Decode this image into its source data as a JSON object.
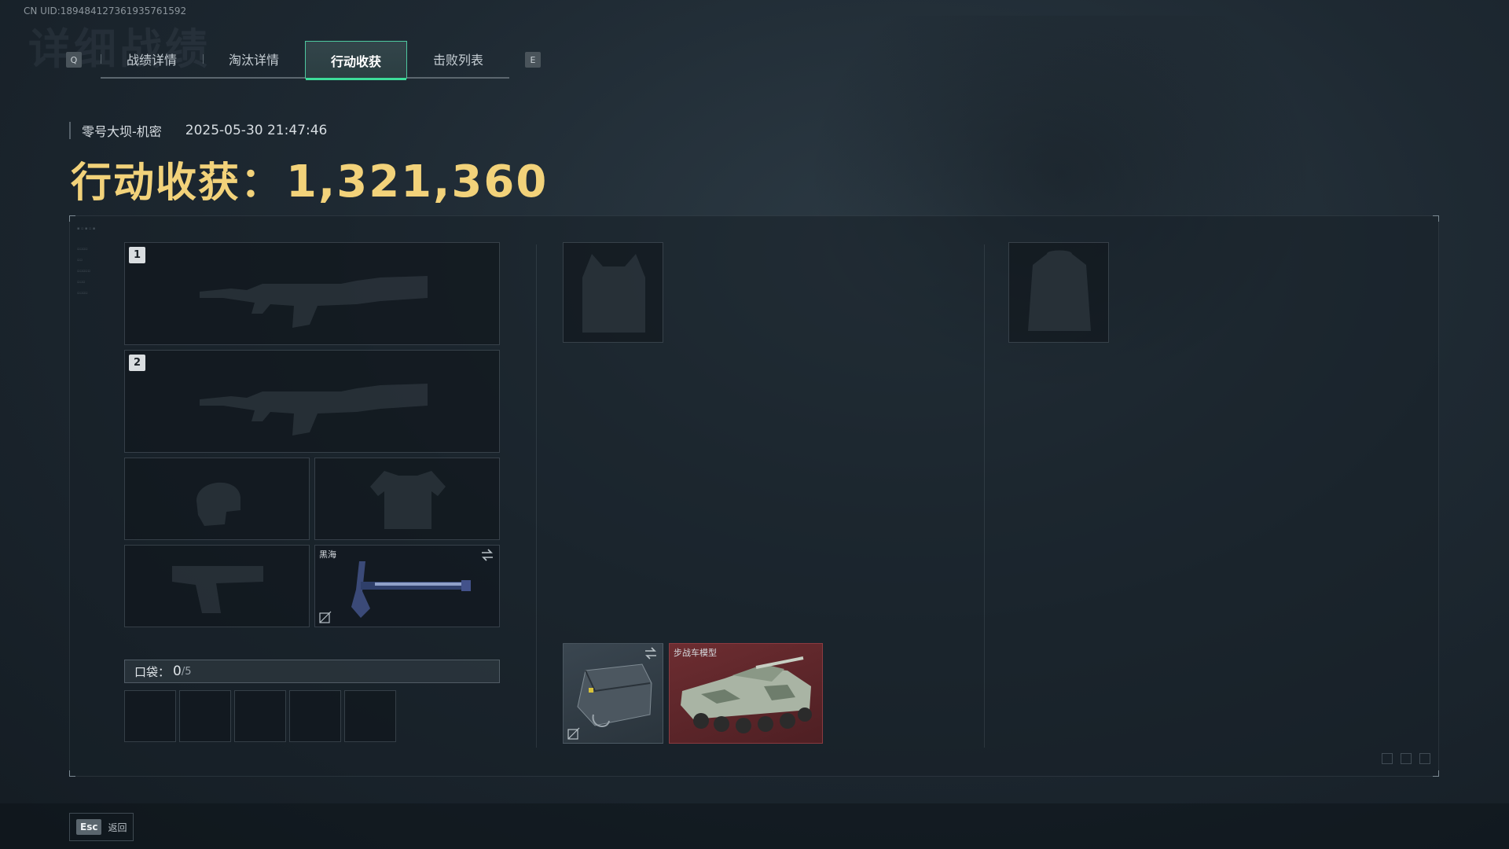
{
  "header": {
    "uid": "CN UID:18948412736193576159​2",
    "bg_title": "详细战绩"
  },
  "tabs": {
    "left_key": "Q",
    "right_key": "E",
    "items": [
      {
        "label": "战绩详情",
        "active": false
      },
      {
        "label": "淘汰详情",
        "active": false
      },
      {
        "label": "行动收获",
        "active": true
      },
      {
        "label": "击败列表",
        "active": false
      }
    ]
  },
  "meta": {
    "map": "零号大坝-机密",
    "time": "2025-05-30 21:47:46"
  },
  "harvest": {
    "label": "行动收获：",
    "value": "1,321,360"
  },
  "loadout": {
    "slot1_num": "1",
    "slot2_num": "2",
    "melee_label": "黑海"
  },
  "pocket": {
    "label": "口袋：",
    "count": "0",
    "max": "/5"
  },
  "loot": {
    "vehicle_label": "步战车模型"
  },
  "footer": {
    "esc_key": "Esc",
    "back_label": "返回"
  },
  "colors": {
    "accent": "#3ddc9a",
    "harvest": "#f2d27a",
    "rare_red": "#6b2a2e"
  }
}
